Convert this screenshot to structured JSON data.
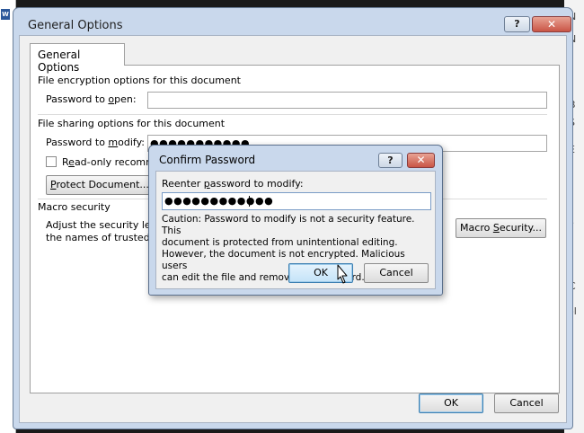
{
  "background": {
    "app_badge": "W",
    "right_edge": [
      "N",
      "N",
      "B",
      "S",
      "E",
      "I",
      "s",
      "C",
      "ol"
    ]
  },
  "window": {
    "title": "General Options",
    "help_label": "?",
    "close_label": "✕"
  },
  "tab": {
    "label": "General Options"
  },
  "encryption": {
    "heading": "File encryption options for this document",
    "password_open_label_pre": "Password to ",
    "password_open_label_accel": "o",
    "password_open_label_post": "pen:",
    "password_open_value": ""
  },
  "sharing": {
    "heading": "File sharing options for this document",
    "password_modify_label_pre": "Password to ",
    "password_modify_label_accel": "m",
    "password_modify_label_post": "odify:",
    "password_modify_value": "●●●●●●●●●●●",
    "readonly_label_accel": "e",
    "readonly_label_pre": "R",
    "readonly_label_post": "ad-only recomme",
    "readonly_checked": false,
    "protect_button_accel": "P",
    "protect_button_post": "rotect Document..."
  },
  "macro": {
    "heading": "Macro security",
    "desc_line1": "Adjust the security leve",
    "desc_line2": "the names of trusted m",
    "button_pre": "Macro ",
    "button_accel": "S",
    "button_post": "ecurity..."
  },
  "footer": {
    "ok_label": "OK",
    "cancel_label": "Cancel"
  },
  "confirm": {
    "title": "Confirm Password",
    "help_label": "?",
    "close_label": "✕",
    "prompt_pre": "Reenter ",
    "prompt_accel": "p",
    "prompt_post": "assword to modify:",
    "password_value": "●●●●●●●●●●●●",
    "caution_line1": "Caution: Password to modify is not a security feature. This",
    "caution_line2": "document is protected from unintentional editing.",
    "caution_line3": "However, the document is not encrypted. Malicious users",
    "caution_line4": "can edit the file and remove the password.",
    "ok_label": "OK",
    "cancel_label": "Cancel"
  },
  "icons": {
    "cursor": "mouse-pointer-icon",
    "checkbox": "checkbox-icon"
  }
}
